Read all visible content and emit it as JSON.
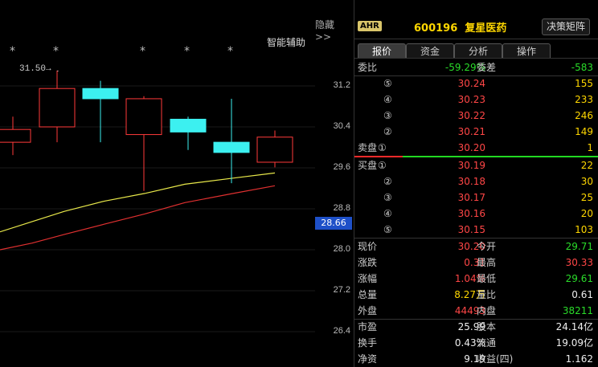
{
  "chart": {
    "hide_label": "隐藏>>",
    "assist_label": "智能辅助",
    "peak_label": "31.50→",
    "current_price": "28.66",
    "stars": [
      "*",
      "*",
      "*",
      "*",
      "*",
      "*"
    ],
    "axis_ticks": [
      "31.2",
      "30.4",
      "29.6",
      "28.8",
      "28.0",
      "27.2",
      "26.4"
    ]
  },
  "chart_data": {
    "type": "candlestick",
    "candles": [
      {
        "open": 30.1,
        "close": 30.35,
        "high": 30.6,
        "low": 29.85,
        "color": "red"
      },
      {
        "open": 30.4,
        "close": 31.15,
        "high": 31.5,
        "low": 30.1,
        "color": "red"
      },
      {
        "open": 31.15,
        "close": 30.95,
        "high": 31.3,
        "low": 30.1,
        "color": "cyan"
      },
      {
        "open": 30.25,
        "close": 30.95,
        "high": 31.0,
        "low": 29.15,
        "color": "red"
      },
      {
        "open": 30.55,
        "close": 30.3,
        "high": 30.6,
        "low": 29.95,
        "color": "cyan"
      },
      {
        "open": 30.1,
        "close": 29.9,
        "high": 30.95,
        "low": 29.3,
        "color": "cyan"
      },
      {
        "open": 29.71,
        "close": 30.2,
        "high": 30.33,
        "low": 29.61,
        "color": "red"
      }
    ],
    "ma_yellow": [
      28.35,
      28.55,
      28.75,
      28.95,
      29.1,
      29.28,
      29.4,
      29.5
    ],
    "ma_red": [
      28.0,
      28.13,
      28.3,
      28.5,
      28.7,
      28.92,
      29.1,
      29.25
    ],
    "ylim": [
      26.0,
      31.8
    ]
  },
  "quote": {
    "badge": "AHR",
    "code": "600196",
    "name": "复星医药",
    "matrix_button": "决策矩阵",
    "tabs": [
      "报价",
      "资金",
      "分析",
      "操作"
    ],
    "weibi_label": "委比",
    "weibi_value": "-59.29%",
    "weicha_label": "委差",
    "weicha_value": "-583",
    "sell_label": "卖盘",
    "buy_label": "买盘",
    "sells": [
      {
        "level": "⑤",
        "price": "30.24",
        "vol": "155"
      },
      {
        "level": "④",
        "price": "30.23",
        "vol": "233"
      },
      {
        "level": "③",
        "price": "30.22",
        "vol": "246"
      },
      {
        "level": "②",
        "price": "30.21",
        "vol": "149"
      },
      {
        "level": "①",
        "price": "30.20",
        "vol": "1"
      }
    ],
    "buys": [
      {
        "level": "①",
        "price": "30.19",
        "vol": "22"
      },
      {
        "level": "②",
        "price": "30.18",
        "vol": "30"
      },
      {
        "level": "③",
        "price": "30.17",
        "vol": "25"
      },
      {
        "level": "④",
        "price": "30.16",
        "vol": "20"
      },
      {
        "level": "⑤",
        "price": "30.15",
        "vol": "103"
      }
    ],
    "stats": [
      {
        "l1": "现价",
        "v1": "30.20",
        "c1": "red",
        "l2": "今开",
        "v2": "29.71",
        "c2": "green"
      },
      {
        "l1": "涨跌",
        "v1": "0.31",
        "c1": "red",
        "l2": "最高",
        "v2": "30.33",
        "c2": "red"
      },
      {
        "l1": "涨幅",
        "v1": "1.04%",
        "c1": "red",
        "l2": "最低",
        "v2": "29.61",
        "c2": "green"
      },
      {
        "l1": "总量",
        "v1": "8.27万",
        "c1": "yellow",
        "l2": "量比",
        "v2": "0.61",
        "c2": "white"
      },
      {
        "l1": "外盘",
        "v1": "44493",
        "c1": "red",
        "l2": "内盘",
        "v2": "38211",
        "c2": "green"
      }
    ],
    "fundamentals": [
      {
        "l1": "市盈",
        "v1": "25.99",
        "l2": "股本",
        "v2": "24.14亿"
      },
      {
        "l1": "换手",
        "v1": "0.43%",
        "l2": "流通",
        "v2": "19.09亿"
      },
      {
        "l1": "净资",
        "v1": "9.19",
        "l2": "收益(四)",
        "v2": "1.162"
      }
    ]
  }
}
